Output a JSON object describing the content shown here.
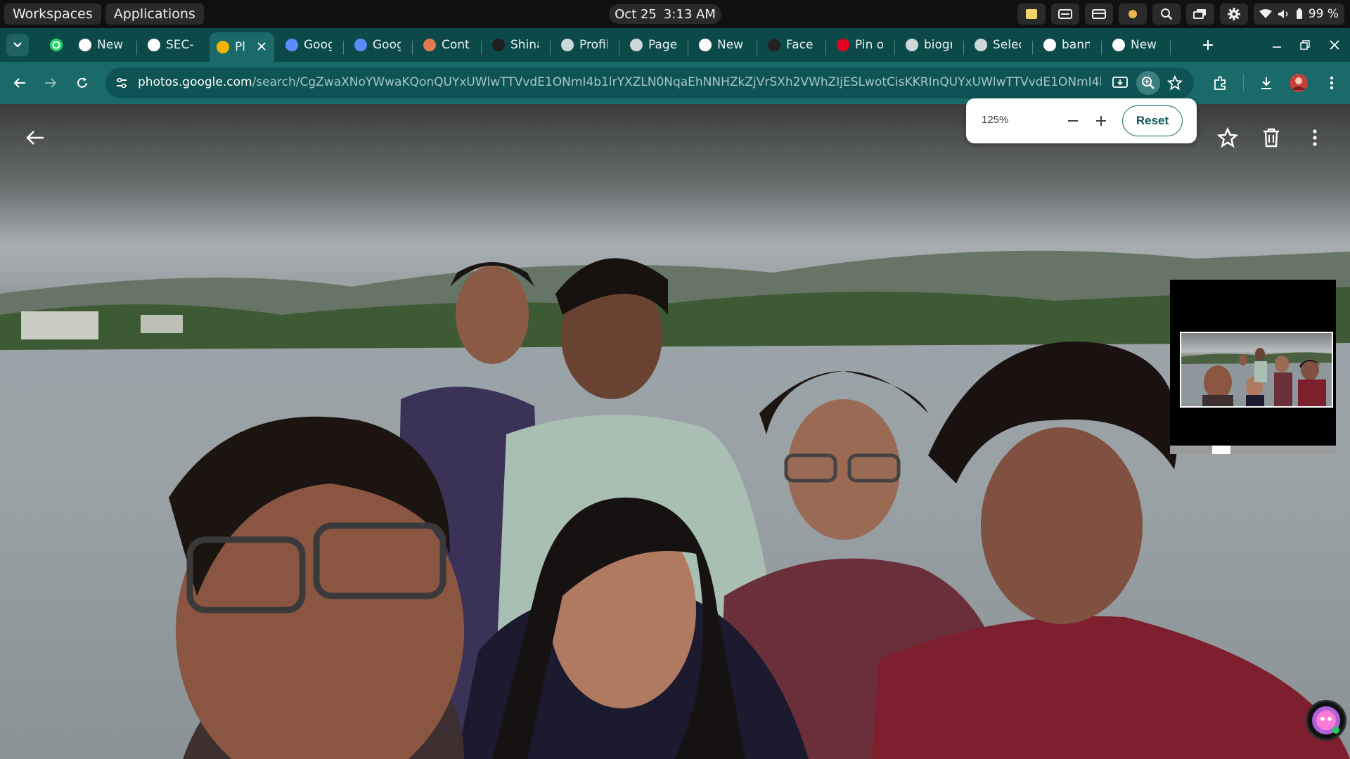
{
  "os": {
    "workspaces_label": "Workspaces",
    "applications_label": "Applications",
    "date": "Oct 25",
    "time": "3:13 AM",
    "battery": "99 %"
  },
  "browser": {
    "active_tab_index": 2,
    "tabs": [
      {
        "label": "New T",
        "icon": "chrome-icon",
        "color": "#ffffff"
      },
      {
        "label": "SEC-U",
        "icon": "drive-triangle-icon",
        "color": "#ffffff"
      },
      {
        "label": "Pl",
        "icon": "google-photos-icon",
        "color": "#f4b400"
      },
      {
        "label": "Goog",
        "icon": "gemini-star-icon",
        "color": "#5b8cff"
      },
      {
        "label": "Goog",
        "icon": "gemini-star-icon",
        "color": "#5b8cff"
      },
      {
        "label": "Conte",
        "icon": "claude-burst-icon",
        "color": "#e07a4f"
      },
      {
        "label": "Shina",
        "icon": "dark-circle-icon",
        "color": "#1f1f1f"
      },
      {
        "label": "Profil",
        "icon": "globe-icon",
        "color": "#cfd8d8"
      },
      {
        "label": "Page",
        "icon": "globe-icon",
        "color": "#cfd8d8"
      },
      {
        "label": "New T",
        "icon": "chrome-icon",
        "color": "#ffffff"
      },
      {
        "label": "Face",
        "icon": "dark-circle-icon",
        "color": "#222222"
      },
      {
        "label": "Pin o",
        "icon": "pinterest-icon",
        "color": "#e60023"
      },
      {
        "label": "biogr",
        "icon": "globe-icon",
        "color": "#cfd8d8"
      },
      {
        "label": "Selec",
        "icon": "globe-icon",
        "color": "#cfd8d8"
      },
      {
        "label": "bann",
        "icon": "google-g-icon",
        "color": "#ffffff"
      },
      {
        "label": "New T",
        "icon": "chrome-icon",
        "color": "#ffffff"
      }
    ],
    "url_host": "photos.google.com",
    "url_path": "/search/CgZwaXNoYWwaKQonQUYxUWlwTTVvdE1ONmI4b1lrYXZLN0NqaEhNNHZkZjVrSXh2VWhZIjESLwotCisKKRInQUYxUWlwTTVvdE1ONmI4b1lrYXZLN0Nqa..."
  },
  "viewer": {
    "zoom_value": "125%",
    "reset_label": "Reset"
  },
  "colors": {
    "tab_strip": "#0c4a4a",
    "toolbar": "#1b6a6a",
    "accent": "#0b6a6a"
  }
}
